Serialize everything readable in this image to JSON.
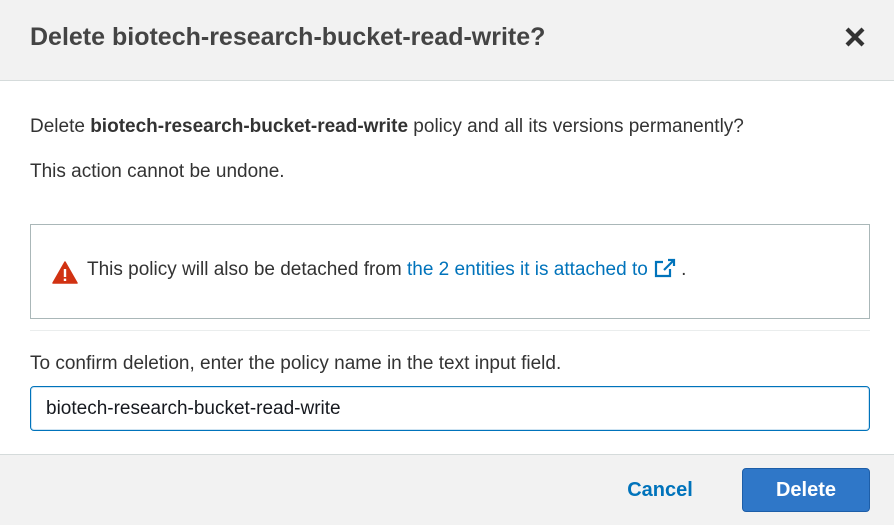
{
  "dialog": {
    "title": "Delete biotech-research-bucket-read-write?",
    "close_icon": "close-icon"
  },
  "body": {
    "line1_prefix": "Delete ",
    "line1_policy": "biotech-research-bucket-read-write",
    "line1_suffix": " policy and all its versions permanently?",
    "line2": "This action cannot be undone."
  },
  "alert": {
    "icon": "warning-icon",
    "text_prefix": "This policy will also be detached from ",
    "link_text": "the 2 entities it is attached to",
    "link_icon": "external-link-icon",
    "text_suffix": " .",
    "warning_color": "#d13212",
    "link_color": "#0073bb"
  },
  "confirm": {
    "label": "To confirm deletion, enter the policy name in the text input field.",
    "input_value": "biotech-research-bucket-read-write"
  },
  "footer": {
    "cancel_label": "Cancel",
    "delete_label": "Delete",
    "primary_color": "#2f77c8"
  }
}
